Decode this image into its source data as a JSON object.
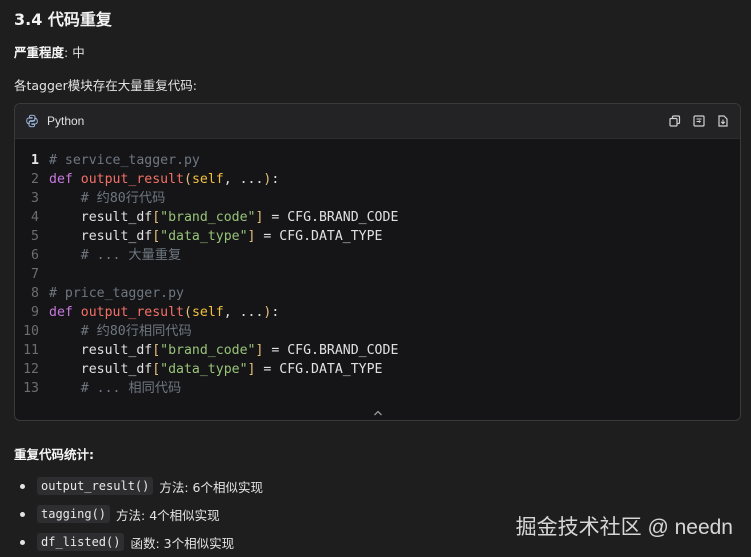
{
  "section": {
    "heading": "3.4 代码重复",
    "severity_label": "严重程度",
    "severity_value": ": 中",
    "intro": "各tagger模块存在大量重复代码:"
  },
  "code_block": {
    "language": "Python",
    "tools": [
      "copy-icon",
      "wrap-icon",
      "download-icon"
    ],
    "lines": [
      {
        "n": "1",
        "tokens": [
          {
            "t": "# service_tagger.py",
            "c": "comment"
          }
        ]
      },
      {
        "n": "2",
        "tokens": [
          {
            "t": "def ",
            "c": "kw"
          },
          {
            "t": "output_result",
            "c": "fnname"
          },
          {
            "t": "(",
            "c": "brack"
          },
          {
            "t": "self",
            "c": "fn"
          },
          {
            "t": ", ...",
            "c": "plain"
          },
          {
            "t": ")",
            "c": "brack"
          },
          {
            "t": ":",
            "c": "plain"
          }
        ]
      },
      {
        "n": "3",
        "tokens": [
          {
            "t": "    # 约80行代码",
            "c": "comment"
          }
        ]
      },
      {
        "n": "4",
        "tokens": [
          {
            "t": "    result_df",
            "c": "plain"
          },
          {
            "t": "[",
            "c": "brack"
          },
          {
            "t": "\"brand_code\"",
            "c": "str"
          },
          {
            "t": "]",
            "c": "brack"
          },
          {
            "t": " = CFG.BRAND_CODE",
            "c": "plain"
          }
        ]
      },
      {
        "n": "5",
        "tokens": [
          {
            "t": "    result_df",
            "c": "plain"
          },
          {
            "t": "[",
            "c": "brack"
          },
          {
            "t": "\"data_type\"",
            "c": "str"
          },
          {
            "t": "]",
            "c": "brack"
          },
          {
            "t": " = CFG.DATA_TYPE",
            "c": "plain"
          }
        ]
      },
      {
        "n": "6",
        "tokens": [
          {
            "t": "    # ... 大量重复",
            "c": "comment"
          }
        ]
      },
      {
        "n": "7",
        "tokens": []
      },
      {
        "n": "8",
        "tokens": [
          {
            "t": "# price_tagger.py",
            "c": "comment"
          }
        ]
      },
      {
        "n": "9",
        "tokens": [
          {
            "t": "def ",
            "c": "kw"
          },
          {
            "t": "output_result",
            "c": "fnname"
          },
          {
            "t": "(",
            "c": "brack"
          },
          {
            "t": "self",
            "c": "fn"
          },
          {
            "t": ", ...",
            "c": "plain"
          },
          {
            "t": ")",
            "c": "brack"
          },
          {
            "t": ":",
            "c": "plain"
          }
        ]
      },
      {
        "n": "10",
        "tokens": [
          {
            "t": "    # 约80行相同代码",
            "c": "comment"
          }
        ]
      },
      {
        "n": "11",
        "tokens": [
          {
            "t": "    result_df",
            "c": "plain"
          },
          {
            "t": "[",
            "c": "brack"
          },
          {
            "t": "\"brand_code\"",
            "c": "str"
          },
          {
            "t": "]",
            "c": "brack"
          },
          {
            "t": " = CFG.BRAND_CODE",
            "c": "plain"
          }
        ]
      },
      {
        "n": "12",
        "tokens": [
          {
            "t": "    result_df",
            "c": "plain"
          },
          {
            "t": "[",
            "c": "brack"
          },
          {
            "t": "\"data_type\"",
            "c": "str"
          },
          {
            "t": "]",
            "c": "brack"
          },
          {
            "t": " = CFG.DATA_TYPE",
            "c": "plain"
          }
        ]
      },
      {
        "n": "13",
        "tokens": [
          {
            "t": "    # ... 相同代码",
            "c": "comment"
          }
        ]
      }
    ]
  },
  "stats": {
    "title": "重复代码统计:",
    "items": [
      {
        "code": "output_result()",
        "text": "方法: 6个相似实现"
      },
      {
        "code": "tagging()",
        "text": "方法: 4个相似实现"
      },
      {
        "code": "df_listed()",
        "text": "函数: 3个相似实现"
      }
    ]
  },
  "watermark": "掘金技术社区 @ needn",
  "colors": {
    "background": "#1e1e1f",
    "code_background": "#151517",
    "keyword": "#c678dd",
    "function_name": "#f47067",
    "string": "#98c379",
    "comment": "#6e7781"
  }
}
